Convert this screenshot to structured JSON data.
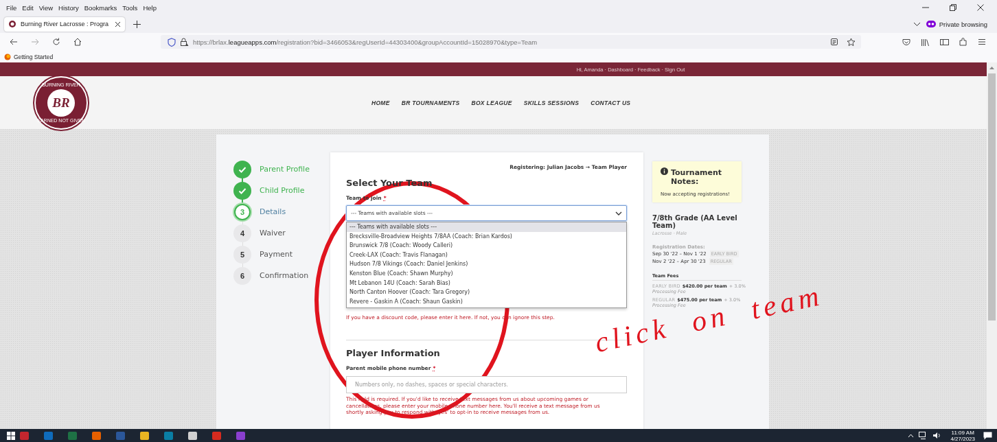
{
  "browser": {
    "menu": [
      "File",
      "Edit",
      "View",
      "History",
      "Bookmarks",
      "Tools",
      "Help"
    ],
    "tabs": [
      {
        "title": "Burning River Lacrosse : Progra",
        "selected": true
      }
    ],
    "private_label": "Private browsing",
    "url": {
      "prefix": "https://brlax.",
      "host": "leagueapps.com",
      "path": "/registration?bid=3466053&regUserId=44303400&groupAccountId=15028970&type=Team"
    },
    "bookmarks": [
      "Getting Started"
    ]
  },
  "site": {
    "user_links": "Hi, Amanda · Dashboard · Feedback · Sign Out",
    "logo": {
      "top": "BURNING RIVER",
      "initials": "BR",
      "bottom": "EARNED NOT GIVEN"
    },
    "nav": [
      "HOME",
      "BR TOURNAMENTS",
      "BOX LEAGUE",
      "SKILLS SESSIONS",
      "CONTACT US"
    ]
  },
  "steps": [
    {
      "label": "Parent Profile",
      "kind": "done"
    },
    {
      "label": "Child Profile",
      "kind": "done"
    },
    {
      "number": "3",
      "label": "Details",
      "kind": "current"
    },
    {
      "number": "4",
      "label": "Waiver",
      "kind": "upcoming"
    },
    {
      "number": "5",
      "label": "Payment",
      "kind": "upcoming"
    },
    {
      "number": "6",
      "label": "Confirmation",
      "kind": "upcoming"
    }
  ],
  "form": {
    "registering": "Registering: Julian Jacobs → Team Player",
    "title": "Select Your Team",
    "team_label": "Team to join",
    "required_mark": "*",
    "team_select": {
      "value": "--- Teams with available slots ---",
      "expanded": true
    },
    "options": [
      {
        "label": "--- Teams with available slots ---",
        "selected": true
      },
      {
        "label": "Brecksville-Broadview Heights 7/8AA (Coach: Brian Kardos)",
        "selected": false
      },
      {
        "label": "Brunswick 7/8 (Coach: Woody Calleri)",
        "selected": false
      },
      {
        "label": "Creek-LAX (Coach: Travis Flanagan)",
        "selected": false
      },
      {
        "label": "Hudson 7/8 Vikings (Coach: Daniel Jenkins)",
        "selected": false
      },
      {
        "label": "Kenston Blue (Coach: Shawn Murphy)",
        "selected": false
      },
      {
        "label": "Mt Lebanon 14U (Coach: Sarah Bias)",
        "selected": false
      },
      {
        "label": "North Canton Hoover (Coach: Tara Gregory)",
        "selected": false
      },
      {
        "label": "Revere - Gaskin A (Coach: Shaun Gaskin)",
        "selected": false
      }
    ],
    "discount_hint": "If you have a discount code, please enter it here. If not, you can ignore this step.",
    "player_title": "Player Information",
    "phone_label": "Parent mobile phone number",
    "phone_required_mark": "*",
    "phone_placeholder": "Numbers only, no dashes, spaces or special characters.",
    "phone_error": "This field is required. If you'd like to receive text messages from us about upcoming games or cancellations, please enter your mobile phone number here. You'll receive a text message from us shortly asking you to respond with 'yes' to opt-in to receive messages from us."
  },
  "sidebar": {
    "notes_title": "Tournament Notes:",
    "notes_text": "Now accepting registrations!",
    "program_title": "7/8th Grade (AA Level Team)",
    "program_sub": "Lacrosse · Male",
    "dates_heading": "Registration Dates:",
    "dates": [
      {
        "range": "Sep 30 '22 – Nov 1 '22",
        "tag": "EARLY BIRD"
      },
      {
        "range": "Nov 2 '22 – Apr 30 '23",
        "tag": "REGULAR"
      }
    ],
    "fees_heading": "Team Fees",
    "fees": [
      {
        "tier": "EARLY BIRD",
        "price": "$420.00 per team",
        "fee": "+ 3.0%",
        "fee_label": "Processing Fee"
      },
      {
        "tier": "REGULAR",
        "price": "$475.00 per team",
        "fee": "+ 3.0%",
        "fee_label": "Processing Fee"
      }
    ]
  },
  "annotation": {
    "text": "click on team"
  },
  "taskbar": {
    "apps": [
      {
        "color": "#c4262e"
      },
      {
        "color": "#0f6cbd"
      },
      {
        "color": "#1e7145"
      },
      {
        "color": "#e66000"
      },
      {
        "color": "#2b579a"
      },
      {
        "color": "#e8b422"
      },
      {
        "color": "#0a7ea4"
      },
      {
        "color": "#d0d0d0"
      },
      {
        "color": "#d62b1f"
      },
      {
        "color": "#8a3fcf"
      }
    ],
    "time": "11:09 AM",
    "date": "4/27/2023"
  }
}
